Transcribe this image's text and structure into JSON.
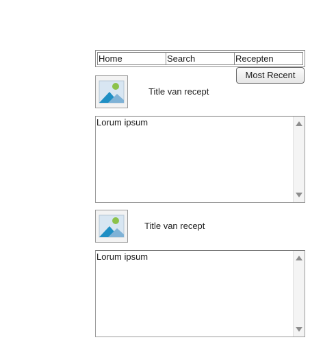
{
  "nav": {
    "items": [
      {
        "label": "Home"
      },
      {
        "label": "Search"
      },
      {
        "label": "Recepten"
      }
    ]
  },
  "sort_button": {
    "label": "Most Recent"
  },
  "recipes": [
    {
      "title": "Title van recept",
      "image_icon": "image-placeholder-icon",
      "body": "Lorum ipsum"
    },
    {
      "title": "Title van recept",
      "image_icon": "image-placeholder-icon",
      "body": "Lorum ipsum"
    }
  ],
  "colors": {
    "image_sky": "#d8e6f2",
    "image_mountain_front": "#1f8fc4",
    "image_mountain_back": "#7fb2d6",
    "image_sun": "#8cc24a"
  }
}
